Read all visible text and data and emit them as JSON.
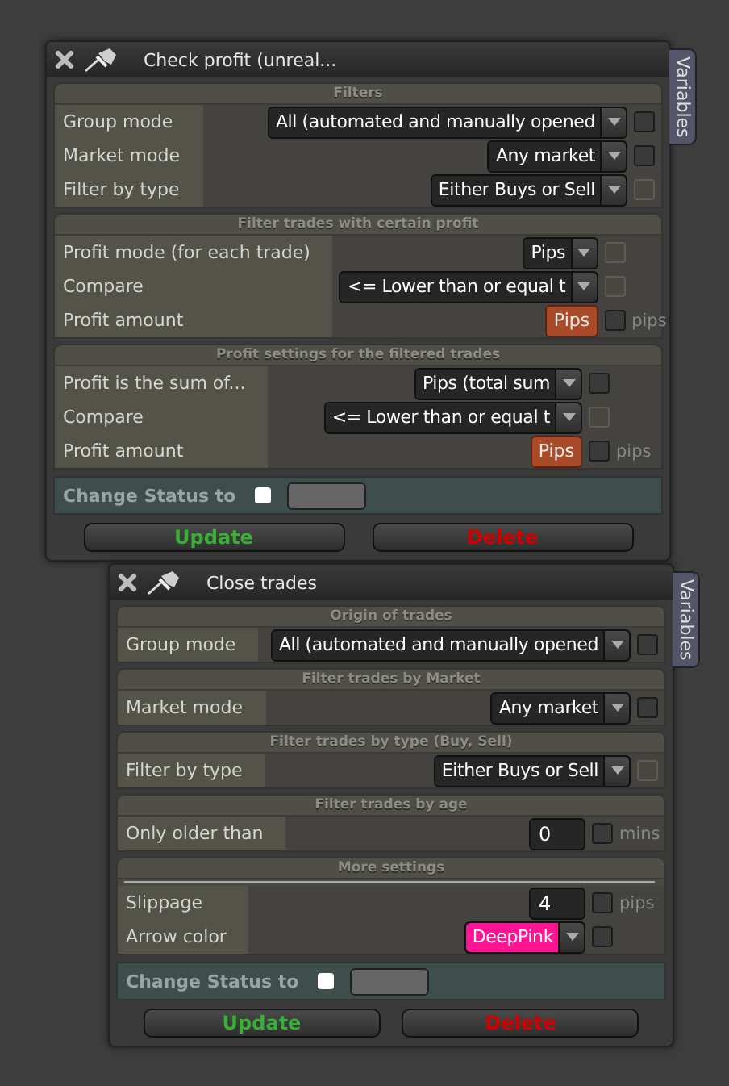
{
  "windows": [
    {
      "title": "Check profit (unreal...",
      "side_tab": "Variables",
      "sections": [
        {
          "header": "Filters",
          "rows": [
            {
              "label": "Group mode",
              "control": {
                "kind": "dropdown",
                "value": "All (automated and manually opened"
              },
              "checkbox": {
                "disabled": false
              }
            },
            {
              "label": "Market mode",
              "control": {
                "kind": "dropdown",
                "value": "Any market"
              },
              "checkbox": {
                "disabled": false
              }
            },
            {
              "label": "Filter by type",
              "control": {
                "kind": "dropdown",
                "value": "Either Buys or Sell"
              },
              "checkbox": {
                "disabled": true
              }
            }
          ]
        },
        {
          "header": "Filter trades with certain profit",
          "rows": [
            {
              "label": "Profit mode (for each trade)",
              "control": {
                "kind": "dropdown",
                "value": "Pips"
              },
              "checkbox": {
                "disabled": true
              }
            },
            {
              "label": "Compare",
              "control": {
                "kind": "dropdown",
                "value": "<= Lower than or equal t"
              },
              "checkbox": {
                "disabled": true
              }
            },
            {
              "label": "Profit amount",
              "control": {
                "kind": "button",
                "value": "Pips"
              },
              "checkbox": {
                "disabled": false
              },
              "unit": "pips"
            }
          ]
        },
        {
          "header": "Profit settings for the filtered trades",
          "rows": [
            {
              "label": "Profit is the sum of...",
              "control": {
                "kind": "dropdown",
                "value": "Pips (total sum"
              },
              "checkbox": {
                "disabled": false
              }
            },
            {
              "label": "Compare",
              "control": {
                "kind": "dropdown",
                "value": "<= Lower than or equal t"
              },
              "checkbox": {
                "disabled": true
              }
            },
            {
              "label": "Profit amount",
              "control": {
                "kind": "button",
                "value": "Pips"
              },
              "checkbox": {
                "disabled": false
              },
              "unit": "pips"
            }
          ]
        }
      ],
      "status": {
        "label": "Change Status to",
        "checked": false
      },
      "buttons": [
        {
          "label": "Update",
          "kind": "update"
        },
        {
          "label": "Delete",
          "kind": "delete"
        }
      ]
    },
    {
      "title": "Close trades",
      "side_tab": "Variables",
      "sections": [
        {
          "header": "Origin of trades",
          "rows": [
            {
              "label": "Group mode",
              "control": {
                "kind": "dropdown",
                "value": "All (automated and manually opened"
              },
              "checkbox": {
                "disabled": false
              }
            }
          ]
        },
        {
          "header": "Filter trades by Market",
          "rows": [
            {
              "label": "Market mode",
              "control": {
                "kind": "dropdown",
                "value": "Any market"
              },
              "checkbox": {
                "disabled": false
              }
            }
          ]
        },
        {
          "header": "Filter trades by type (Buy, Sell)",
          "rows": [
            {
              "label": "Filter by type",
              "control": {
                "kind": "dropdown",
                "value": "Either Buys or Sell"
              },
              "checkbox": {
                "disabled": true
              }
            }
          ]
        },
        {
          "header": "Filter trades by age",
          "rows": [
            {
              "label": "Only older than",
              "control": {
                "kind": "number",
                "value": "0"
              },
              "checkbox": {
                "disabled": false
              },
              "unit": "mins"
            }
          ]
        },
        {
          "header": "More settings",
          "divider": true,
          "rows": [
            {
              "label": "Slippage",
              "control": {
                "kind": "number",
                "value": "4"
              },
              "checkbox": {
                "disabled": false
              },
              "unit": "pips"
            },
            {
              "label": "Arrow color",
              "control": {
                "kind": "color",
                "value": "DeepPink",
                "color": "#ff1493"
              },
              "checkbox": {
                "disabled": false
              }
            }
          ]
        }
      ],
      "status": {
        "label": "Change Status to",
        "checked": false
      },
      "buttons": [
        {
          "label": "Update",
          "kind": "update"
        },
        {
          "label": "Delete",
          "kind": "delete"
        }
      ]
    }
  ]
}
